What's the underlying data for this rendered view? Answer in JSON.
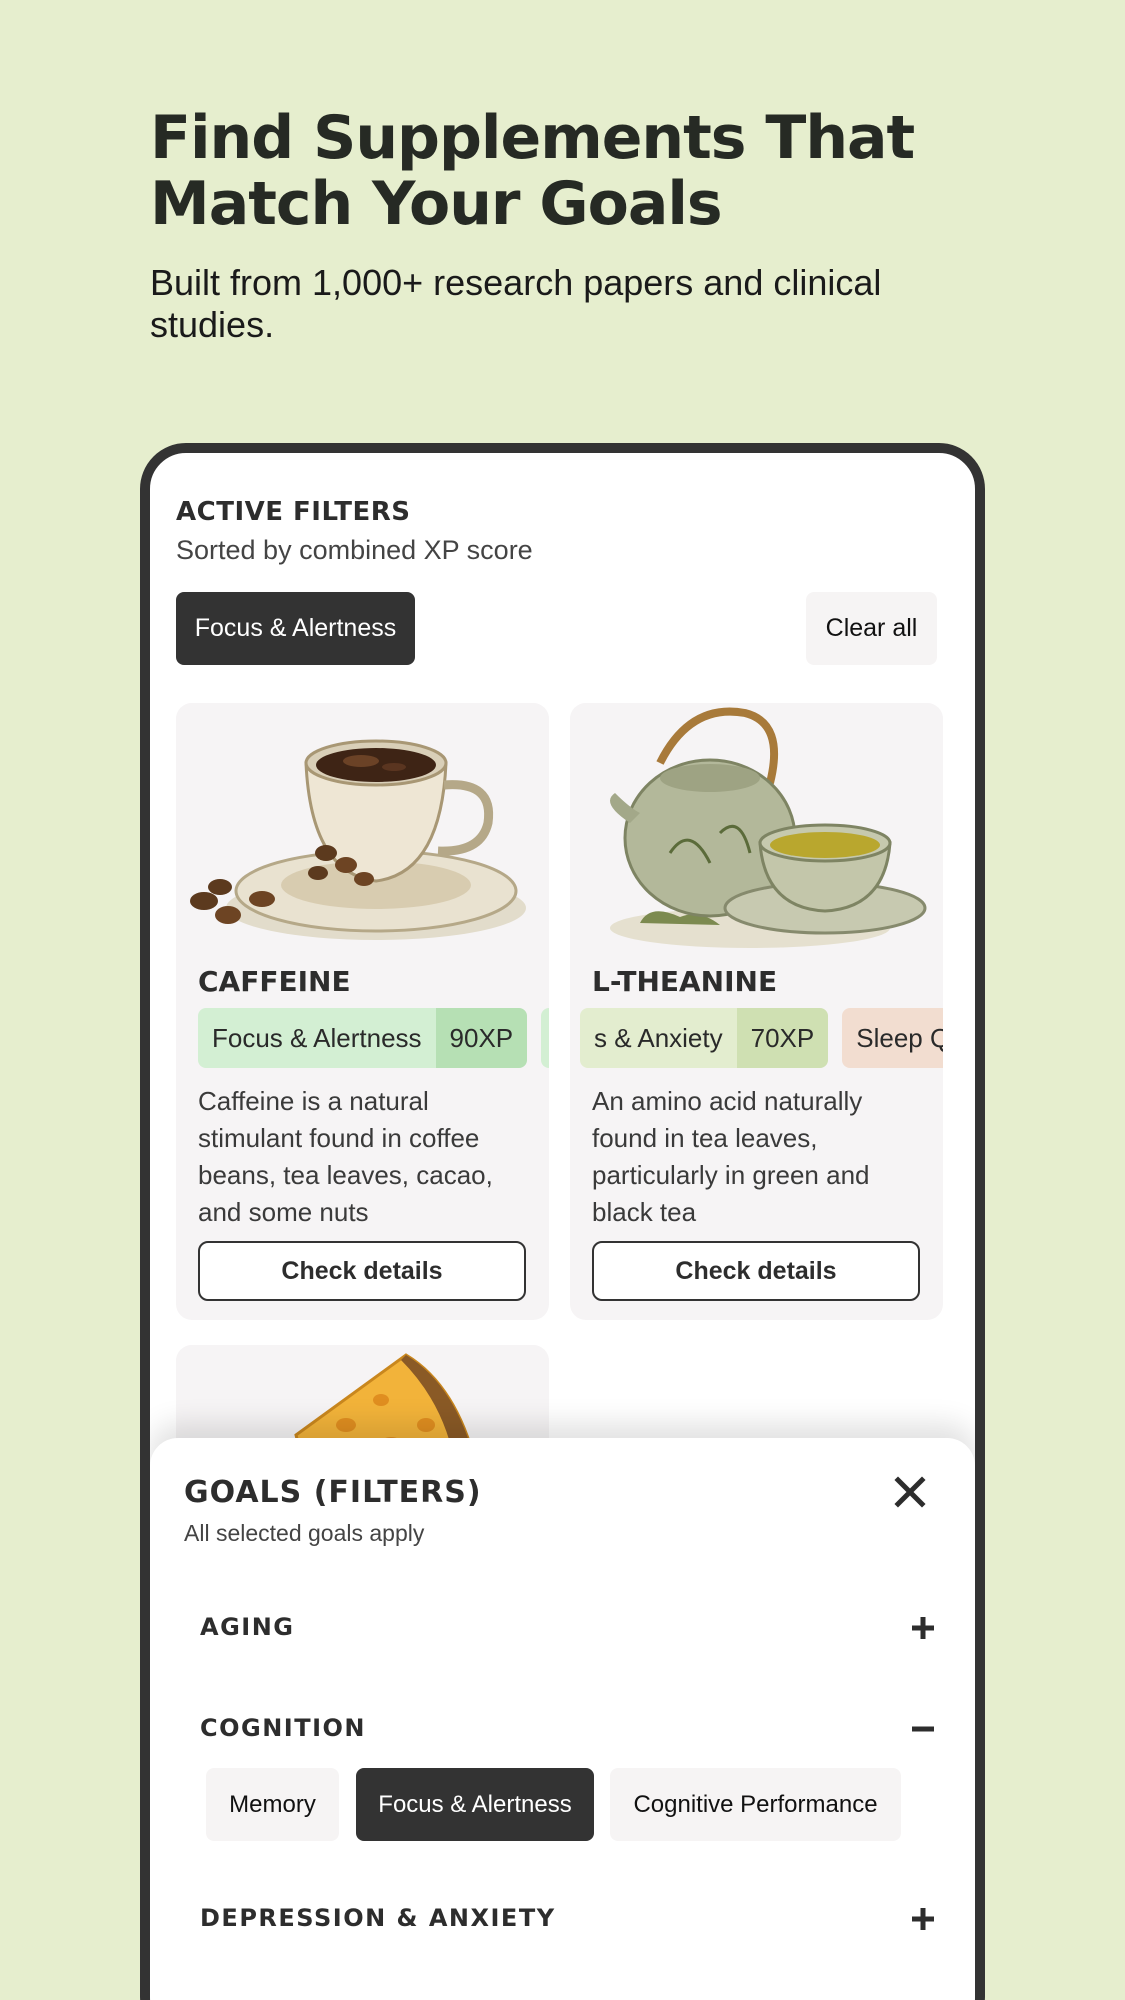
{
  "hero": {
    "title": "Find Supplements That Match Your Goals",
    "subtitle": "Built from 1,000+ research papers and clinical studies."
  },
  "filters": {
    "heading": "ACTIVE FILTERS",
    "sort_text": "Sorted by combined XP score",
    "active": [
      "Focus & Alertness"
    ],
    "clear_label": "Clear all"
  },
  "cards": [
    {
      "title": "CAFFEINE",
      "image": "coffee-cup-illustration",
      "tags": [
        {
          "name": "Focus & Alertness",
          "xp": "90XP",
          "color": "#d3efd3"
        }
      ],
      "description": "Caffeine is a natural stimulant found in coffee beans, tea leaves, cacao, and some nuts",
      "button": "Check details"
    },
    {
      "title": "L-THEANINE",
      "image": "green-tea-illustration",
      "tags": [
        {
          "name": "s & Anxiety",
          "xp": "70XP",
          "color": "#e3edcf"
        },
        {
          "name": "Sleep Qu",
          "xp": "",
          "color": "#f2ddd0"
        }
      ],
      "description": "An amino acid naturally found in tea leaves, particularly in green and black tea",
      "button": "Check details"
    },
    {
      "title": "",
      "image": "cheese-illustration"
    }
  ],
  "sheet": {
    "title": "GOALS (FILTERS)",
    "subtitle": "All selected goals apply",
    "groups": [
      {
        "label": "AGING",
        "expanded": false
      },
      {
        "label": "COGNITION",
        "expanded": true,
        "options": [
          {
            "label": "Memory",
            "selected": false
          },
          {
            "label": "Focus & Alertness",
            "selected": true
          },
          {
            "label": "Cognitive Performance",
            "selected": false
          }
        ]
      },
      {
        "label": "DEPRESSION & ANXIETY",
        "expanded": false
      }
    ]
  },
  "colors": {
    "background": "#e6eece",
    "dark": "#333333",
    "card": "#f6f4f5"
  }
}
